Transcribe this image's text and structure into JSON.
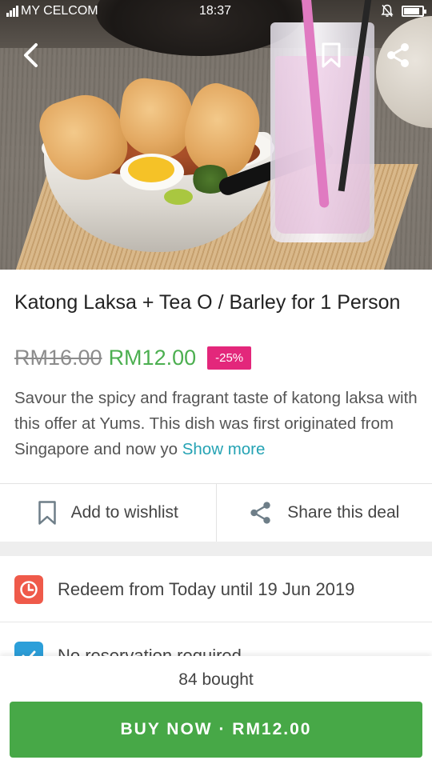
{
  "status_bar": {
    "carrier": "MY CELCOM",
    "time": "18:37",
    "battery_level": 0.85,
    "icons": [
      "signal-icon",
      "mute-bell-icon",
      "battery-icon"
    ]
  },
  "hero": {
    "icons": [
      "back-arrow-icon",
      "bookmark-icon",
      "share-icon"
    ]
  },
  "deal": {
    "title": "Katong Laksa + Tea O / Barley for 1 Person",
    "old_price": "RM16.00",
    "new_price": "RM12.00",
    "discount": "-25%",
    "description": "Savour the spicy and fragrant taste of katong laksa with this offer at Yums. This dish was first originated from Singapore and now yo",
    "show_more": "Show more"
  },
  "actions": {
    "wishlist_label": "Add to wishlist",
    "share_label": "Share this deal",
    "icons": [
      "bookmark-outline-icon",
      "share-icon"
    ]
  },
  "info": {
    "redeem_text": "Redeem from Today until 19 Jun 2019",
    "reservation_text": "No reservation required",
    "icons": [
      "clock-icon",
      "check-icon"
    ]
  },
  "bottom": {
    "bought": "84 bought",
    "buy_label": "BUY NOW · RM12.00"
  },
  "colors": {
    "accent_green": "#47a847",
    "price_green": "#4caf50",
    "discount_pink": "#e3277b",
    "link_teal": "#25a3b4",
    "clock_red": "#ef5a4a",
    "check_blue": "#2c9fd9"
  }
}
